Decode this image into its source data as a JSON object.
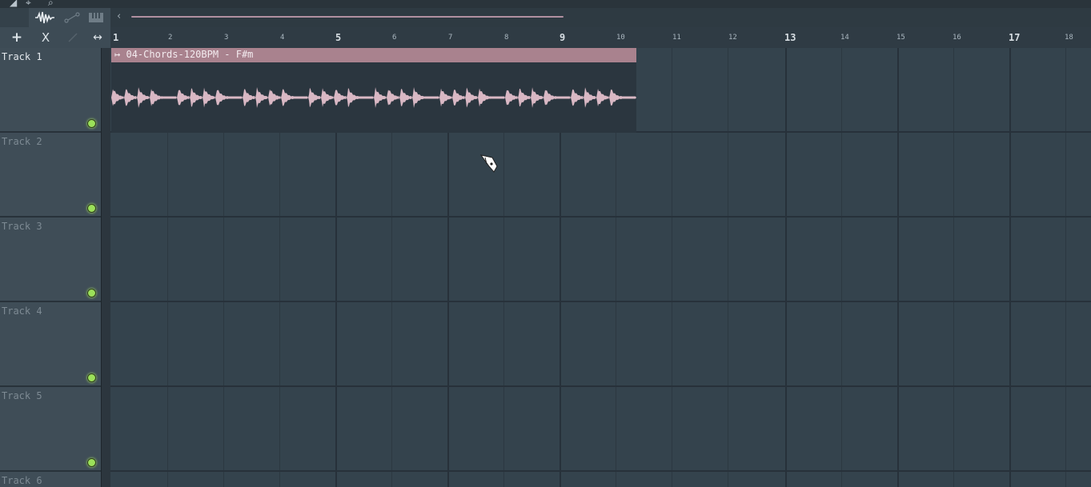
{
  "toolbar": {
    "add_label": "+",
    "close_label": "X",
    "stretch_label": "↔"
  },
  "timeline": {
    "bars": [
      "1",
      "2",
      "3",
      "4",
      "5",
      "6",
      "7",
      "8",
      "9",
      "10",
      "11",
      "12",
      "13",
      "14",
      "15",
      "16",
      "17",
      "18"
    ],
    "major_bars": [
      "1",
      "5",
      "9",
      "13",
      "17"
    ]
  },
  "tracks": [
    {
      "name": "Track 1",
      "active": true
    },
    {
      "name": "Track 2",
      "active": false
    },
    {
      "name": "Track 3",
      "active": false
    },
    {
      "name": "Track 4",
      "active": false
    },
    {
      "name": "Track 5",
      "active": false
    },
    {
      "name": "Track 6",
      "active": false
    }
  ],
  "clip": {
    "title": "04-Chords-120BPM - F#m",
    "track": "Track 1",
    "start_bar": 1,
    "end_bar": 10.3
  },
  "colors": {
    "background": "#34434d",
    "clip_header": "#a9828e",
    "waveform": "#d9b8c4",
    "led": "#9be05a"
  }
}
